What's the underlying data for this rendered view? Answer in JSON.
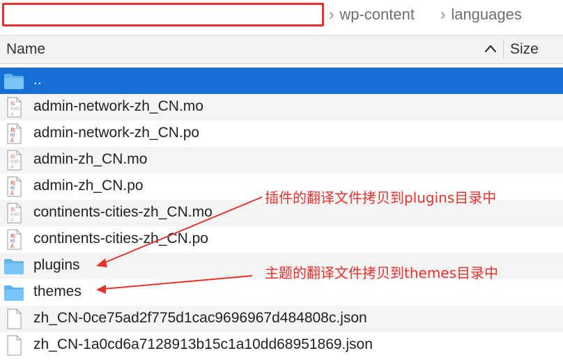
{
  "breadcrumb": [
    "wp-content",
    "languages"
  ],
  "header": {
    "name_label": "Name",
    "size_label": "Size"
  },
  "files": [
    {
      "name": "..",
      "type": "folder",
      "selected": true
    },
    {
      "name": "admin-network-zh_CN.mo",
      "type": "mo"
    },
    {
      "name": "admin-network-zh_CN.po",
      "type": "po"
    },
    {
      "name": "admin-zh_CN.mo",
      "type": "mo"
    },
    {
      "name": "admin-zh_CN.po",
      "type": "po"
    },
    {
      "name": "continents-cities-zh_CN.mo",
      "type": "mo"
    },
    {
      "name": "continents-cities-zh_CN.po",
      "type": "po"
    },
    {
      "name": "plugins",
      "type": "folder"
    },
    {
      "name": "themes",
      "type": "folder"
    },
    {
      "name": "zh_CN-0ce75ad2f775d1cac9696967d484808c.json",
      "type": "json"
    },
    {
      "name": "zh_CN-1a0cd6a7128913b15c1a10dd68951869.json",
      "type": "json"
    }
  ],
  "annotations": {
    "plugins_note": "插件的翻译文件拷贝到plugins目录中",
    "themes_note": "主题的翻译文件拷贝到themes目录中"
  },
  "colors": {
    "selection": "#1a6fd6",
    "annotation": "#e8312a",
    "folder": "#6ec3f2"
  }
}
